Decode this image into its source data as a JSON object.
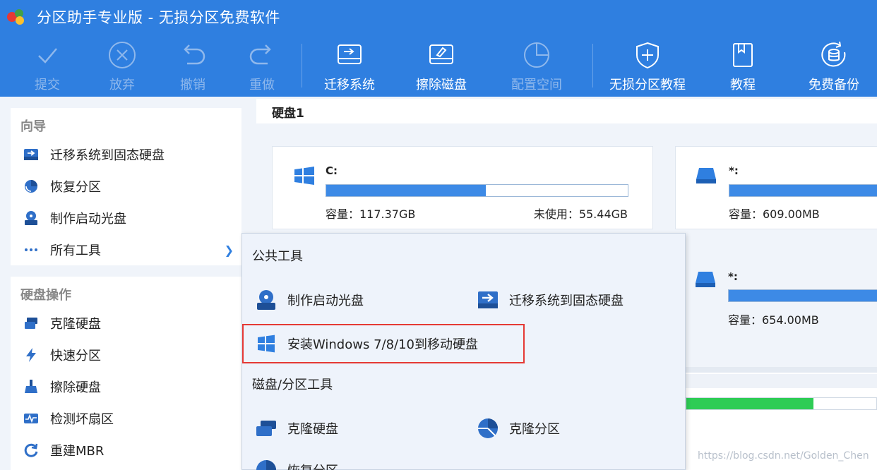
{
  "window": {
    "title": "分区助手专业版 - 无损分区免费软件"
  },
  "toolbar": {
    "commit": "提交",
    "discard": "放弃",
    "undo": "撤销",
    "redo": "重做",
    "migrate_os": "迁移系统",
    "wipe_disk": "擦除磁盘",
    "allocate_space": "配置空间",
    "lossless_tutorial": "无损分区教程",
    "tutorial": "教程",
    "free_backup": "免费备份"
  },
  "wizard": {
    "title": "向导",
    "items": [
      "迁移系统到固态硬盘",
      "恢复分区",
      "制作启动光盘",
      "所有工具"
    ]
  },
  "disk_ops": {
    "title": "硬盘操作",
    "items": [
      "克隆硬盘",
      "快速分区",
      "擦除硬盘",
      "检测坏扇区",
      "重建MBR"
    ]
  },
  "disk_header": "硬盘1",
  "partitions": [
    {
      "name": "C:",
      "capacity": "容量：117.37GB",
      "unused": "未使用：55.44GB",
      "used_fraction": 0.53
    },
    {
      "name": "*:",
      "capacity": "容量：609.00MB",
      "used_fraction": 1.0
    },
    {
      "name": "*:",
      "capacity": "容量：654.00MB",
      "used_fraction": 1.0
    }
  ],
  "popup": {
    "section_public": "公共工具",
    "make_boot_cd": "制作启动光盘",
    "migrate_ssd": "迁移系统到固态硬盘",
    "install_windows": "安装Windows 7/8/10到移动硬盘",
    "section_disk": "磁盘/分区工具",
    "clone_disk": "克隆硬盘",
    "clone_partition": "克隆分区",
    "restore_partition": "恢复分区"
  },
  "lower_partition": {
    "used_fraction": 0.67
  },
  "watermark": "https://blog.csdn.net/Golden_Chen",
  "colors": {
    "accent": "#2f7fe0",
    "highlight": "#e53935",
    "bar_blue": "#3d8ae6",
    "bar_green": "#2ecc55"
  }
}
